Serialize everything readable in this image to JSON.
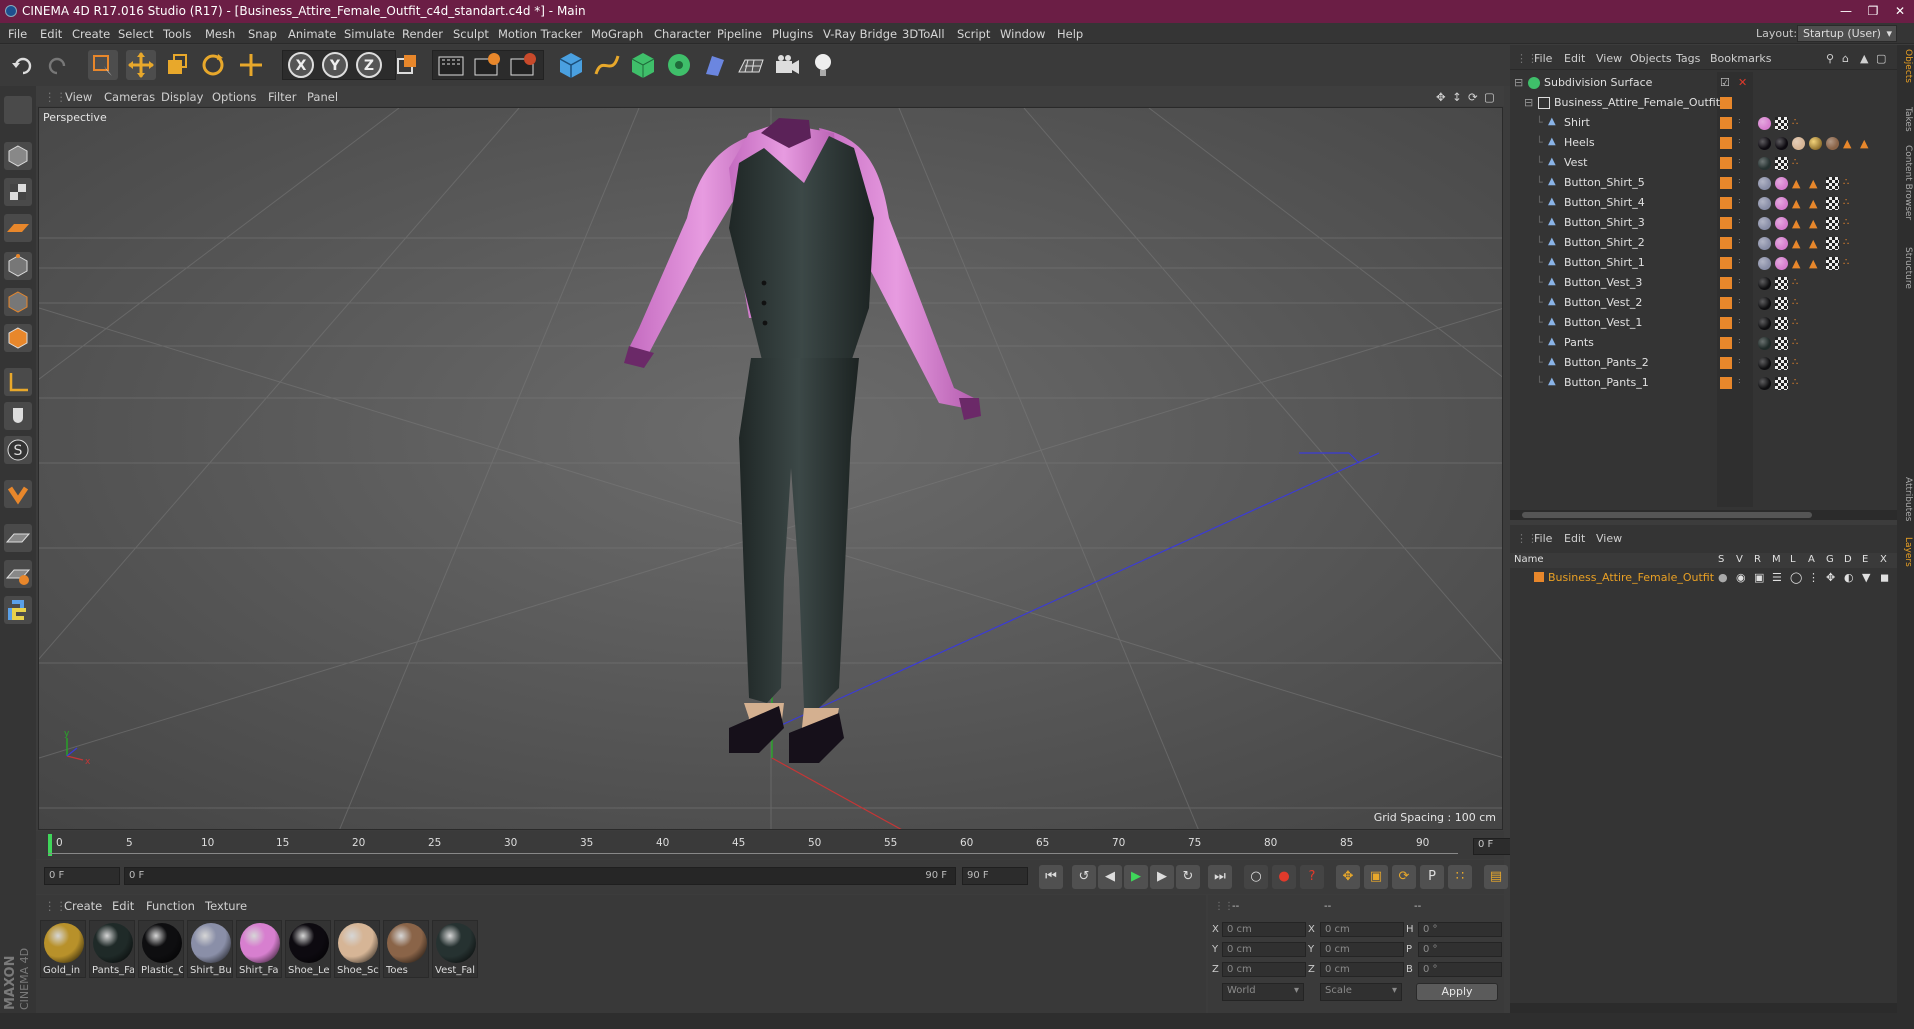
{
  "window": {
    "title": "CINEMA 4D R17.016 Studio (R17) - [Business_Attire_Female_Outfit_c4d_standart.c4d *] - Main",
    "layout_label": "Layout:",
    "layout_value": "Startup (User)"
  },
  "menu": [
    "File",
    "Edit",
    "Create",
    "Select",
    "Tools",
    "Mesh",
    "Snap",
    "Animate",
    "Simulate",
    "Render",
    "Sculpt",
    "Motion Tracker",
    "MoGraph",
    "Character",
    "Pipeline",
    "Plugins",
    "V-Ray Bridge",
    "3DToAll",
    "Script",
    "Window",
    "Help"
  ],
  "viewport": {
    "menu": [
      "View",
      "Cameras",
      "Display",
      "Options",
      "Filter",
      "Panel"
    ],
    "name": "Perspective",
    "grid_spacing": "Grid Spacing : 100 cm"
  },
  "timeline": {
    "ticks": [
      "0",
      "5",
      "10",
      "15",
      "20",
      "25",
      "30",
      "35",
      "40",
      "45",
      "50",
      "55",
      "60",
      "65",
      "70",
      "75",
      "80",
      "85",
      "90"
    ],
    "current_frame": "0 F",
    "start_field": "0 F",
    "range_start": "0 F",
    "range_end": "90 F",
    "end_field": "90 F"
  },
  "materials": {
    "menu": [
      "Create",
      "Edit",
      "Function",
      "Texture"
    ],
    "items": [
      {
        "label": "Gold_in",
        "color": "#b8912a"
      },
      {
        "label": "Pants_Fa",
        "color": "#1f2a28"
      },
      {
        "label": "Plastic_C",
        "color": "#0e0e10"
      },
      {
        "label": "Shirt_Bu",
        "color": "#8a8fa8"
      },
      {
        "label": "Shirt_Fa",
        "color": "#d77fcf"
      },
      {
        "label": "Shoe_Le",
        "color": "#0d0a10"
      },
      {
        "label": "Shoe_Sc",
        "color": "#d6b596"
      },
      {
        "label": "Toes",
        "color": "#8a6448"
      },
      {
        "label": "Vest_Fal",
        "color": "#263231"
      }
    ]
  },
  "coords": {
    "headers": [
      "--",
      "--",
      "--"
    ],
    "rows": [
      {
        "a": "X",
        "av": "0 cm",
        "b": "X",
        "bv": "0 cm",
        "c": "H",
        "cv": "0 °"
      },
      {
        "a": "Y",
        "av": "0 cm",
        "b": "Y",
        "bv": "0 cm",
        "c": "P",
        "cv": "0 °"
      },
      {
        "a": "Z",
        "av": "0 cm",
        "b": "Z",
        "bv": "0 cm",
        "c": "B",
        "cv": "0 °"
      }
    ],
    "mode1": "World",
    "mode2": "Scale",
    "apply": "Apply"
  },
  "object_manager": {
    "menu": [
      "File",
      "Edit",
      "View",
      "Objects",
      "Tags",
      "Bookmarks"
    ],
    "root": "Subdivision Surface",
    "group": "Business_Attire_Female_Outfit",
    "objects": [
      "Shirt",
      "Heels",
      "Vest",
      "Button_Shirt_5",
      "Button_Shirt_4",
      "Button_Shirt_3",
      "Button_Shirt_2",
      "Button_Shirt_1",
      "Button_Vest_3",
      "Button_Vest_2",
      "Button_Vest_1",
      "Pants",
      "Button_Pants_2",
      "Button_Pants_1"
    ]
  },
  "layer_manager": {
    "menu": [
      "File",
      "Edit",
      "View"
    ],
    "name_header": "Name",
    "flags": [
      "S",
      "V",
      "R",
      "M",
      "L",
      "A",
      "G",
      "D",
      "E",
      "X"
    ],
    "layer": "Business_Attire_Female_Outfit"
  },
  "right_tabs": [
    "Objects",
    "Takes",
    "Content Browser",
    "Structure",
    "Attributes",
    "Layers"
  ],
  "colors": {
    "title_bg": "#6b1e45",
    "accent": "#e8872b",
    "layer_text": "#e9a024"
  }
}
